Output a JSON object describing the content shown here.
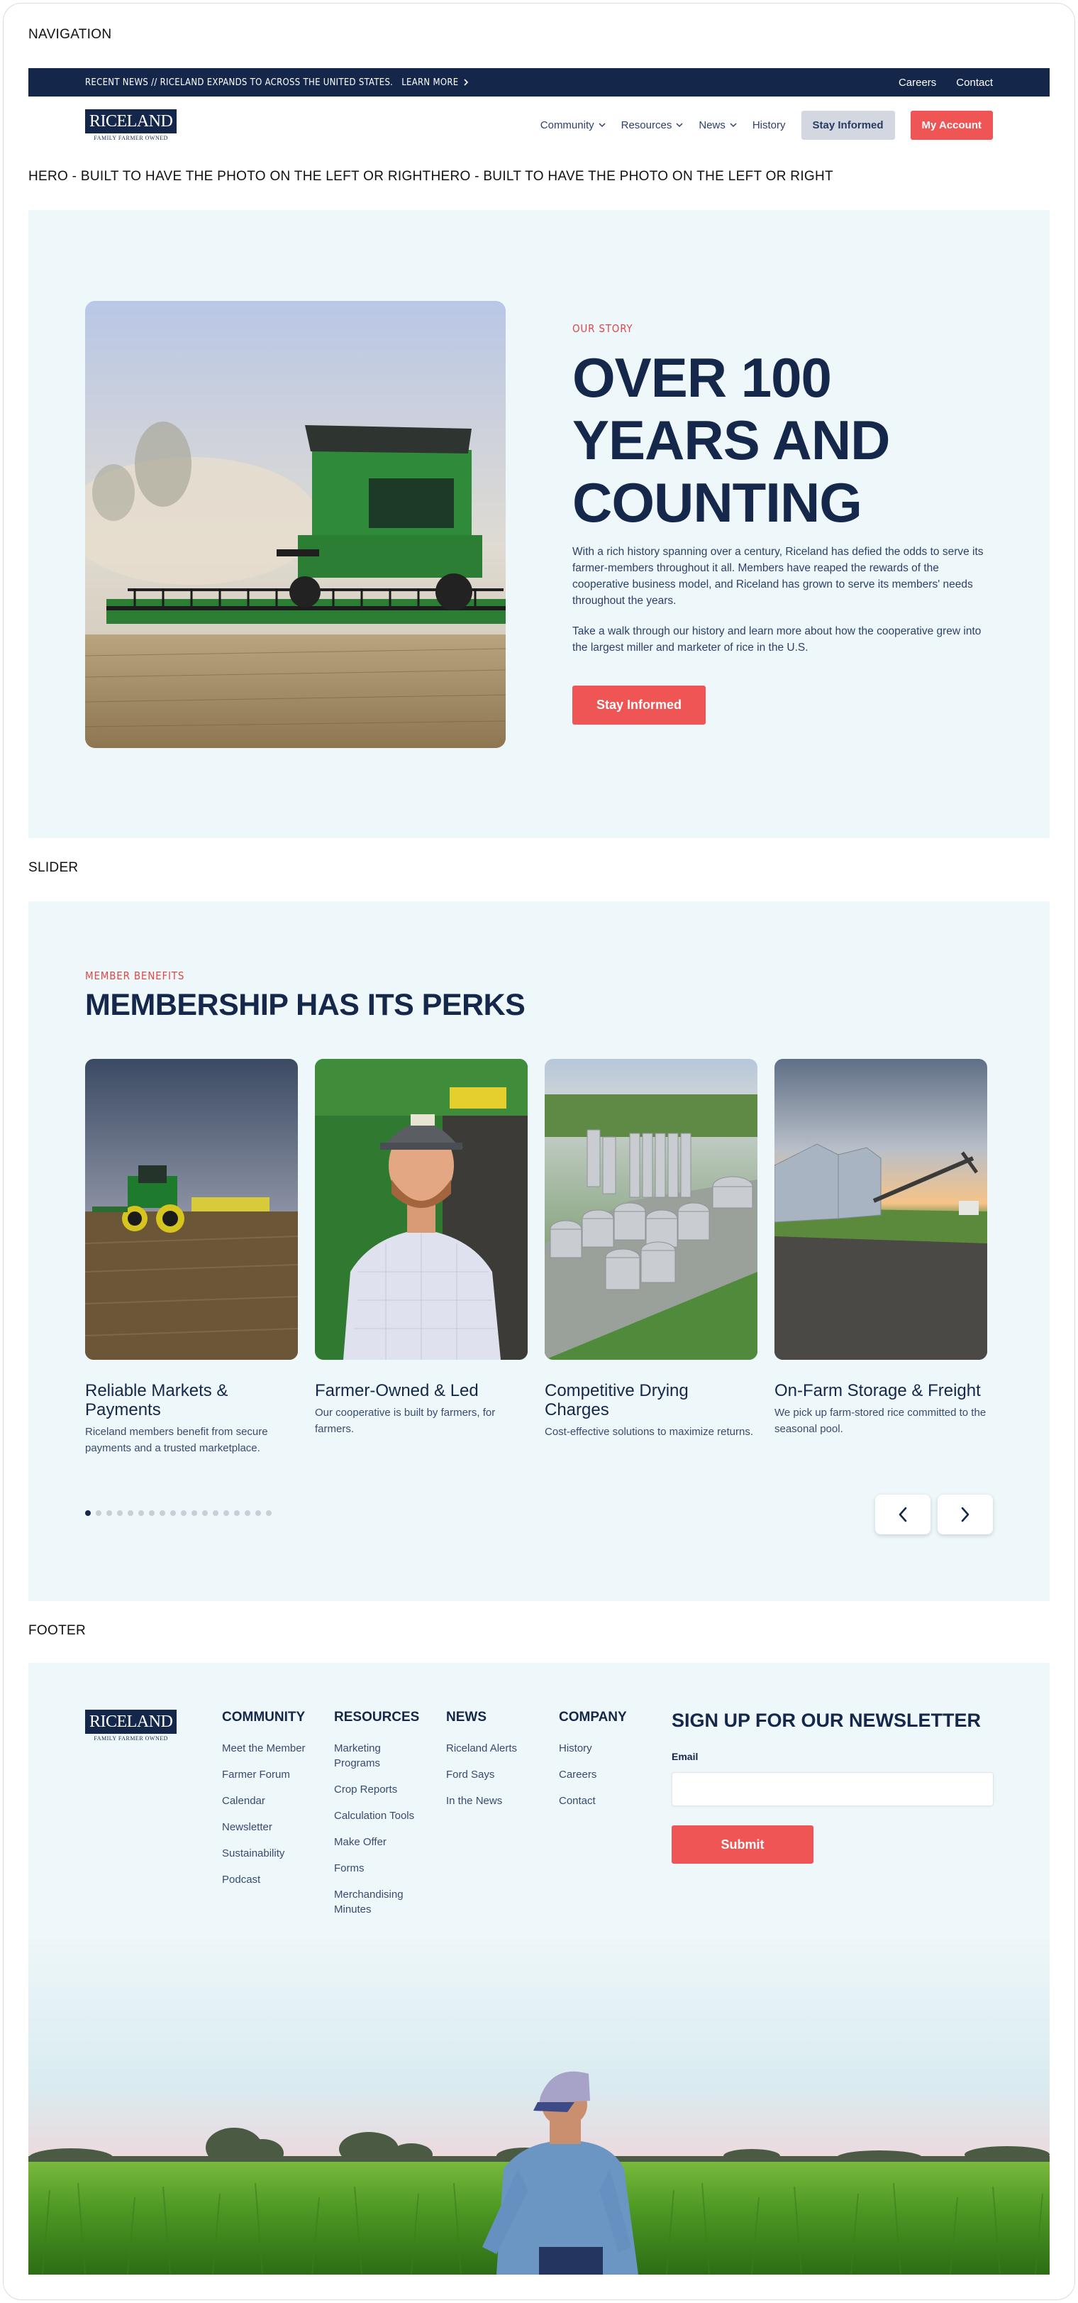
{
  "sections": {
    "navigation": "NAVIGATION",
    "hero": "HERO - BUILT TO HAVE THE PHOTO ON THE LEFT OR RIGHTHERO - BUILT TO HAVE THE PHOTO ON THE LEFT OR RIGHT",
    "slider": "SLIDER",
    "footer": "FOOTER"
  },
  "topbar": {
    "news": "RECENT NEWS // RICELAND EXPANDS TO ACROSS THE UNITED STATES.",
    "learn_more": "LEARN MORE",
    "links": [
      "Careers",
      "Contact"
    ]
  },
  "logo": {
    "word": "RICELAND",
    "tagline": "FAMILY FARMER OWNED"
  },
  "menu": {
    "community": "Community",
    "resources": "Resources",
    "news": "News",
    "history": "History",
    "stay_informed": "Stay Informed",
    "my_account": "My Account"
  },
  "hero": {
    "eyebrow": "OUR STORY",
    "title": "OVER 100 YEARS AND COUNTING",
    "p1": "With a rich history spanning over a century, Riceland has defied the odds to serve its farmer-members throughout it all. Members have reaped the rewards of the cooperative business model, and Riceland has grown to serve its members' needs throughout the years.",
    "p2": "Take a walk through our history and learn more about how the cooperative grew into the largest miller and marketer of rice in the U.S.",
    "button": "Stay Informed"
  },
  "slider": {
    "eyebrow": "MEMBER BENEFITS",
    "title": "MEMBERSHIP HAS ITS PERKS",
    "cards": [
      {
        "title": "Reliable Markets & Payments",
        "desc": "Riceland members benefit from secure payments and a trusted marketplace."
      },
      {
        "title": "Farmer-Owned & Led",
        "desc": "Our cooperative is built by farmers, for farmers."
      },
      {
        "title": "Competitive Drying Charges",
        "desc": "Cost-effective solutions to maximize returns."
      },
      {
        "title": "On-Farm Storage & Freight",
        "desc": "We pick up farm-stored rice committed to the seasonal pool."
      }
    ],
    "dot_count": 18,
    "active_dot": 0
  },
  "footer": {
    "community": {
      "heading": "COMMUNITY",
      "links": [
        "Meet the Member",
        "Farmer Forum",
        "Calendar",
        "Newsletter",
        "Sustainability",
        "Podcast"
      ]
    },
    "resources": {
      "heading": "RESOURCES",
      "links": [
        "Marketing Programs",
        "Crop Reports",
        "Calculation Tools",
        "Make Offer",
        "Forms",
        "Merchandising Minutes"
      ]
    },
    "news": {
      "heading": "NEWS",
      "links": [
        "Riceland Alerts",
        "Ford Says",
        "In the News"
      ]
    },
    "company": {
      "heading": "COMPANY",
      "links": [
        "History",
        "Careers",
        "Contact"
      ]
    },
    "newsletter": {
      "heading": "SIGN UP FOR OUR NEWSLETTER",
      "email_label": "Email",
      "email_value": "",
      "submit": "Submit"
    }
  },
  "colors": {
    "navy": "#15284b",
    "red": "#f05555",
    "panel": "#eef7f9"
  }
}
